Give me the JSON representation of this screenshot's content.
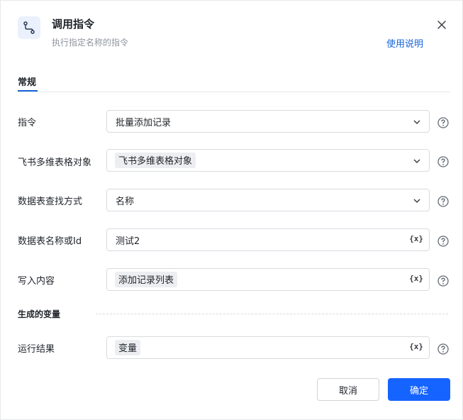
{
  "header": {
    "title": "调用指令",
    "subtitle": "执行指定名称的指令",
    "help_link": "使用说明",
    "icon": "command-flow-icon"
  },
  "tabs": [
    {
      "label": "常规",
      "active": true
    }
  ],
  "fields": {
    "command": {
      "label": "指令",
      "value": "批量添加记录",
      "type": "select"
    },
    "feishu_object": {
      "label": "飞书多维表格对象",
      "value": "飞书多维表格对象",
      "type": "select-tag"
    },
    "lookup_method": {
      "label": "数据表查找方式",
      "value": "名称",
      "type": "select"
    },
    "table_name": {
      "label": "数据表名称或Id",
      "value": "测试2",
      "type": "variable-input"
    },
    "write_content": {
      "label": "写入内容",
      "value": "添加记录列表",
      "type": "variable-input-tag"
    }
  },
  "variables_section": {
    "label": "生成的变量",
    "result": {
      "label": "运行结果",
      "value": "变量"
    }
  },
  "variable_button_text": "{x}",
  "footer": {
    "cancel_label": "取消",
    "confirm_label": "确定"
  },
  "colors": {
    "accent": "#1664ff",
    "link": "#1664d9",
    "border": "#d8dbe0",
    "tag_bg": "#eceef1"
  }
}
